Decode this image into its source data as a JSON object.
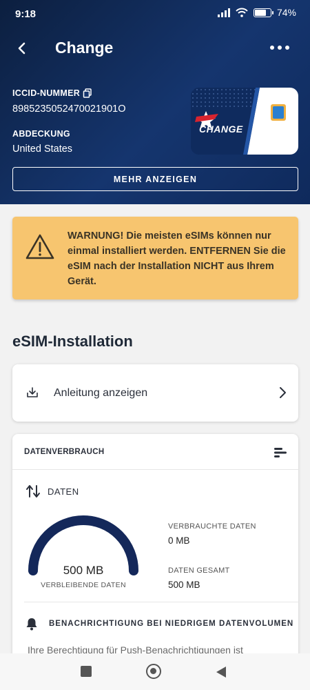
{
  "status_bar": {
    "time": "9:18",
    "battery": "74%",
    "battery_level": 0.74
  },
  "header": {
    "title": "Change",
    "iccid_label": "ICCID-NUMMER",
    "iccid_value": "8985235052470021901O",
    "coverage_label": "ABDECKUNG",
    "coverage_value": "United States",
    "card_brand": "CHANGE",
    "more_button": "MEHR ANZEIGEN"
  },
  "warning": {
    "text": "WARNUNG! Die meisten eSIMs können nur einmal installiert werden. ENTFERNEN Sie die eSIM nach der Installation NICHT aus Ihrem Gerät."
  },
  "installation": {
    "title": "eSIM-Installation",
    "guide_label": "Anleitung anzeigen"
  },
  "usage": {
    "title": "DATENVERBRAUCH",
    "data_label": "DATEN",
    "gauge_value": "500 MB",
    "gauge_caption": "VERBLEIBENDE DATEN",
    "remaining_fraction": 1.0,
    "used_label": "VERBRAUCHTE DATEN",
    "used_value": "0 MB",
    "total_label": "DATEN GESAMT",
    "total_value": "500 MB",
    "notify_title": "BENACHRICHTIGUNG BEI NIEDRIGEM DATENVOLUMEN",
    "notify_text": "Ihre Berechtigung für Push-Benachrichtigungen ist"
  },
  "colors": {
    "header_bg": "#15356e",
    "warning_bg": "#f7c56f",
    "gauge": "#14285a",
    "card_red": "#d8242f"
  },
  "icons": {
    "back": "chevron-left-icon",
    "more": "more-dots-icon",
    "copy": "copy-icon",
    "warning": "warning-triangle-icon",
    "download": "download-icon",
    "chevron": "chevron-right-icon",
    "menu": "bars-menu-icon",
    "data": "arrows-up-down-icon",
    "bell": "bell-icon"
  }
}
